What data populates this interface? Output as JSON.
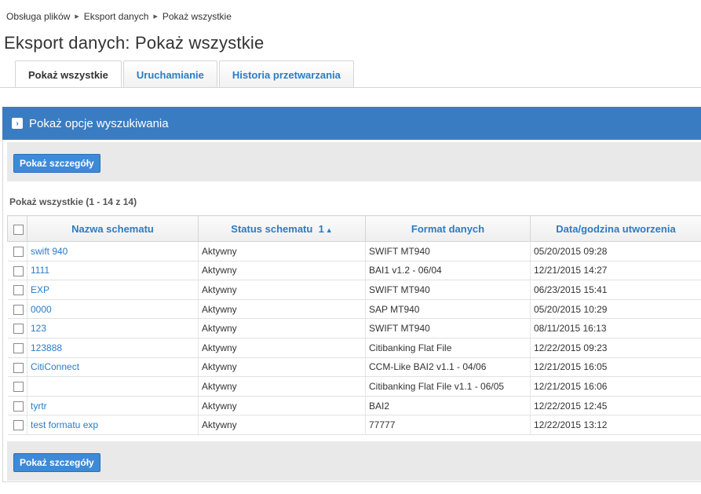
{
  "breadcrumb": {
    "items": [
      "Obsługa plików",
      "Eksport danych",
      "Pokaż wszystkie"
    ]
  },
  "page": {
    "title": "Eksport danych: Pokaż wszystkie"
  },
  "tabs": [
    {
      "label": "Pokaż wszystkie",
      "active": true
    },
    {
      "label": "Uruchamianie",
      "active": false
    },
    {
      "label": "Historia przetwarzania",
      "active": false
    }
  ],
  "search_panel": {
    "label": "Pokaż opcje wyszukiwania",
    "expander_glyph": "›"
  },
  "toolbar": {
    "details_button_label": "Pokaż szczegóły"
  },
  "results": {
    "count_label": "Pokaż wszystkie (1 - 14 z 14)"
  },
  "table": {
    "columns": {
      "name": "Nazwa schematu",
      "status": "Status schematu",
      "status_sort": "1",
      "status_sort_glyph": "▲",
      "format": "Format danych",
      "created": "Data/godzina utworzenia"
    },
    "rows": [
      {
        "name": "swift 940",
        "status": "Aktywny",
        "format": "SWIFT MT940",
        "created": "05/20/2015 09:28"
      },
      {
        "name": "1111",
        "status": "Aktywny",
        "format": "BAI1 v1.2 - 06/04",
        "created": "12/21/2015 14:27"
      },
      {
        "name": "EXP",
        "status": "Aktywny",
        "format": "SWIFT MT940",
        "created": "06/23/2015 15:41"
      },
      {
        "name": "0000",
        "status": "Aktywny",
        "format": "SAP MT940",
        "created": "05/20/2015 10:29"
      },
      {
        "name": "123",
        "status": "Aktywny",
        "format": "SWIFT MT940",
        "created": "08/11/2015 16:13"
      },
      {
        "name": "123888",
        "status": "Aktywny",
        "format": "Citibanking Flat File",
        "created": "12/22/2015 09:23"
      },
      {
        "name": "CitiConnect",
        "status": "Aktywny",
        "format": "CCM-Like BAI2 v1.1 - 04/06",
        "created": "12/21/2015 16:05"
      },
      {
        "name": "",
        "status": "Aktywny",
        "format": "Citibanking Flat File v1.1 - 06/05",
        "created": "12/21/2015 16:06"
      },
      {
        "name": "tyrtr",
        "status": "Aktywny",
        "format": "BAI2",
        "created": "12/22/2015 12:45"
      },
      {
        "name": "test formatu exp",
        "status": "Aktywny",
        "format": "77777",
        "created": "12/22/2015 13:12"
      }
    ]
  },
  "colors": {
    "accent": "#3a7cc2",
    "link": "#2a7cc7",
    "button": "#3d8bd8"
  }
}
